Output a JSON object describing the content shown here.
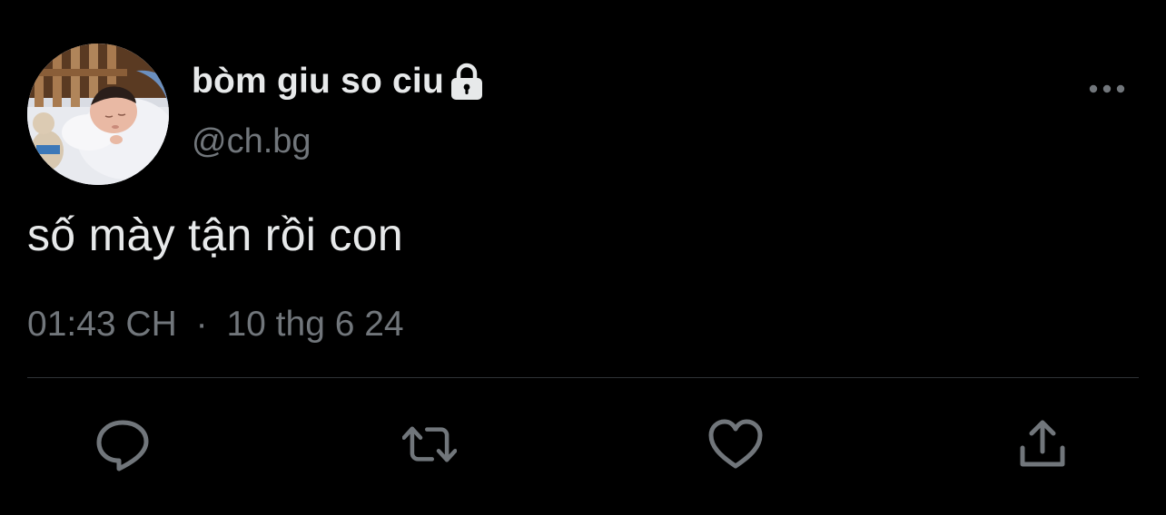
{
  "tweet": {
    "display_name": "bòm giu so ciu",
    "handle": "@ch.bg",
    "protected": true,
    "text": "số mày tận rồi con",
    "time": "01:43 CH",
    "separator": "·",
    "date": "10 thg 6 24"
  },
  "icons": {
    "avatar": "profile-photo",
    "lock": "lock-icon",
    "more": "more-horizontal-icon",
    "reply": "reply-bubble-icon",
    "retweet": "retweet-icon",
    "like": "heart-icon",
    "share": "share-icon"
  },
  "colors": {
    "background": "#000000",
    "primary_text": "#e7e9ea",
    "secondary_text": "#71767b",
    "divider": "#2f3336"
  }
}
